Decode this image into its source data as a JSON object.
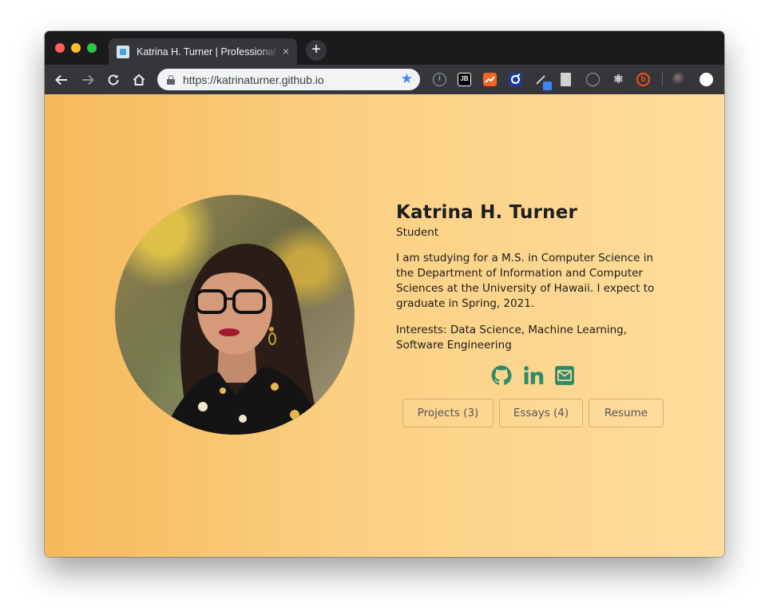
{
  "browser": {
    "tab_title": "Katrina H. Turner | Professional Portfolio",
    "tab_close": "×",
    "new_tab": "+",
    "url": "https://katrinaturner.github.io",
    "extensions": [
      {
        "name": "info-icon",
        "label": "i"
      },
      {
        "name": "jetbrains-icon",
        "label": "JB"
      },
      {
        "name": "chart-extension-icon",
        "label": ""
      },
      {
        "name": "css-extension-icon",
        "label": ""
      },
      {
        "name": "pen-extension-icon",
        "label": ""
      },
      {
        "name": "document-extension-icon",
        "label": ""
      },
      {
        "name": "clock-extension-icon",
        "label": ""
      },
      {
        "name": "react-devtools-icon",
        "label": "⚛"
      },
      {
        "name": "b-extension-icon",
        "label": "b"
      },
      {
        "name": "profile-avatar",
        "label": ""
      },
      {
        "name": "white-circle-extension-icon",
        "label": ""
      }
    ]
  },
  "profile": {
    "name": "Katrina H. Turner",
    "role": "Student",
    "bio": "I am studying for a M.S. in Computer Science in the Department of Information and Computer Sciences at the University of Hawaii. I expect to graduate in Spring, 2021.",
    "interests": "Interests: Data Science, Machine Learning, Software Engineering"
  },
  "socials": [
    {
      "name": "github-icon"
    },
    {
      "name": "linkedin-icon"
    },
    {
      "name": "email-icon"
    }
  ],
  "buttons": {
    "projects": "Projects (3)",
    "essays": "Essays (4)",
    "resume": "Resume"
  },
  "colors": {
    "accent": "#2e8a6a",
    "page_gradient_start": "#f6b95a",
    "page_gradient_end": "#fedd9c",
    "tab_bar": "#1b1b1d",
    "toolbar": "#35363a"
  }
}
